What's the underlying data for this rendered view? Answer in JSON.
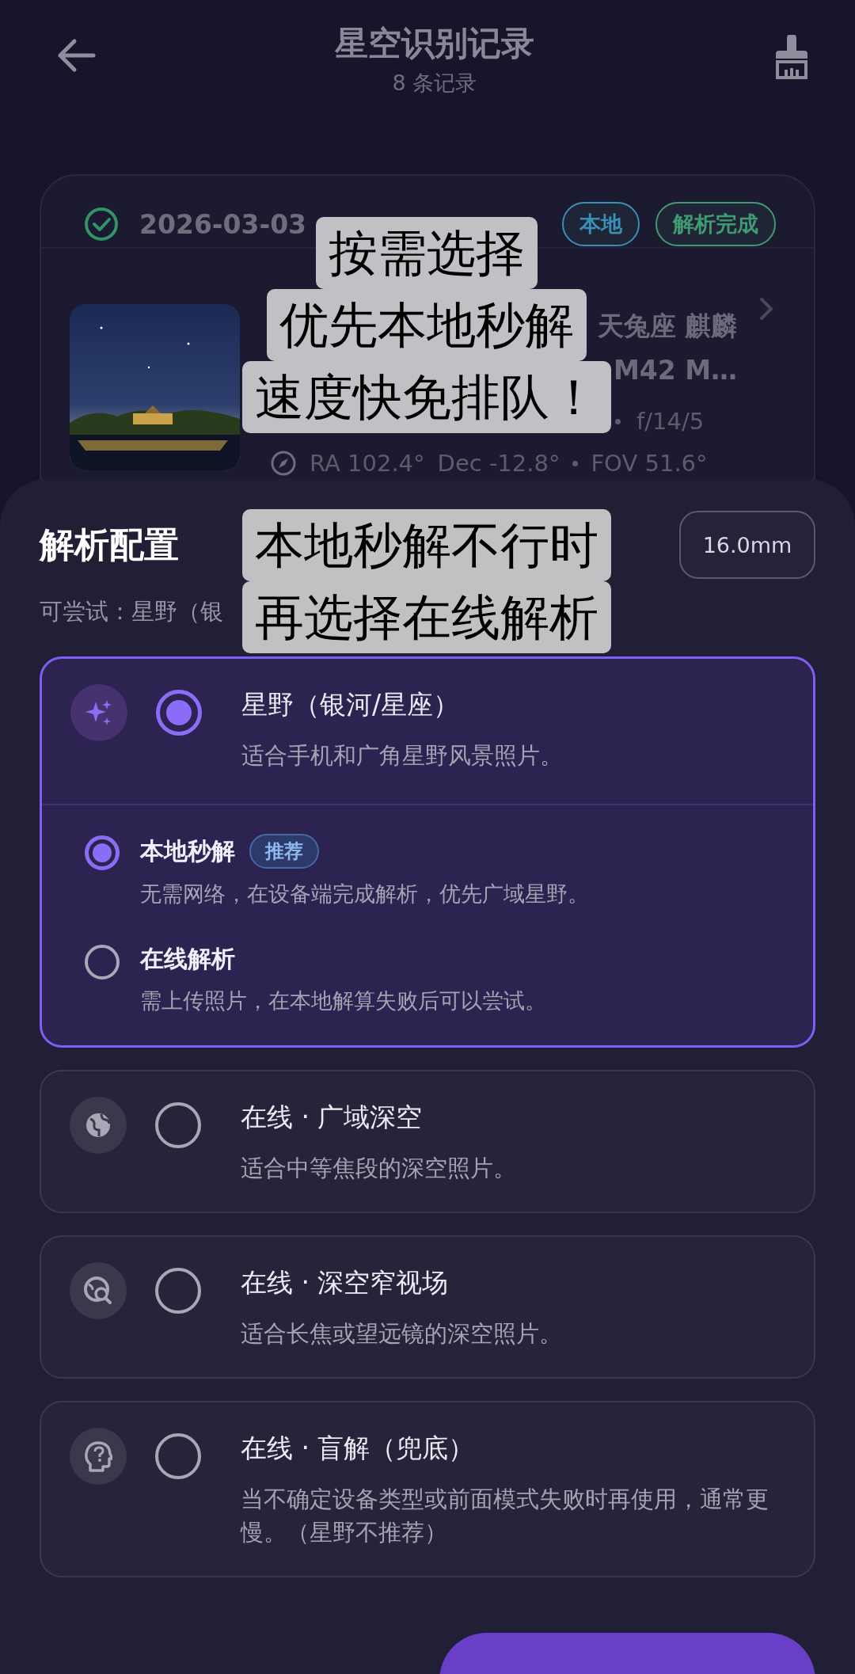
{
  "header": {
    "title": "星空识别记录",
    "subtitle": "8 条记录"
  },
  "record": {
    "date": "2026-03-03",
    "tags": [
      {
        "label": "本地",
        "color": "#3a8fb5"
      },
      {
        "label": "解析完成",
        "color": "#3f9c72"
      }
    ],
    "title_lines": [
      "天兔座 麒麟",
      "M42 M…"
    ],
    "meta": "f/14/5",
    "coords": [
      "RA 102.4°",
      "Dec -12.8°",
      "FOV 51.6°"
    ]
  },
  "sheet": {
    "title": "解析配置",
    "focal_chip": "16.0mm",
    "hint": "可尝试：星野（银",
    "modes": [
      {
        "title": "星野（银河/星座）",
        "description": "适合手机和广角星野风景照片。",
        "selected": true,
        "options": [
          {
            "label": "本地秒解",
            "badge": "推荐",
            "description": "无需网络，在设备端完成解析，优先广域星野。",
            "selected": true
          },
          {
            "label": "在线解析",
            "description": "需上传照片，在本地解算失败后可以尝试。",
            "selected": false
          }
        ]
      },
      {
        "title": "在线 · 广域深空",
        "description": "适合中等焦段的深空照片。",
        "selected": false
      },
      {
        "title": "在线 · 深空窄视场",
        "description": "适合长焦或望远镜的深空照片。",
        "selected": false
      },
      {
        "title": "在线 · 盲解（兜底）",
        "description": "当不确定设备类型或前面模式失败时再使用，通常更慢。（星野不推荐）",
        "selected": false
      }
    ]
  },
  "captions": [
    {
      "lines": [
        "按需选择",
        "优先本地秒解",
        "速度快免排队！"
      ]
    },
    {
      "lines": [
        "本地秒解不行时",
        "再选择在线解析"
      ]
    }
  ]
}
